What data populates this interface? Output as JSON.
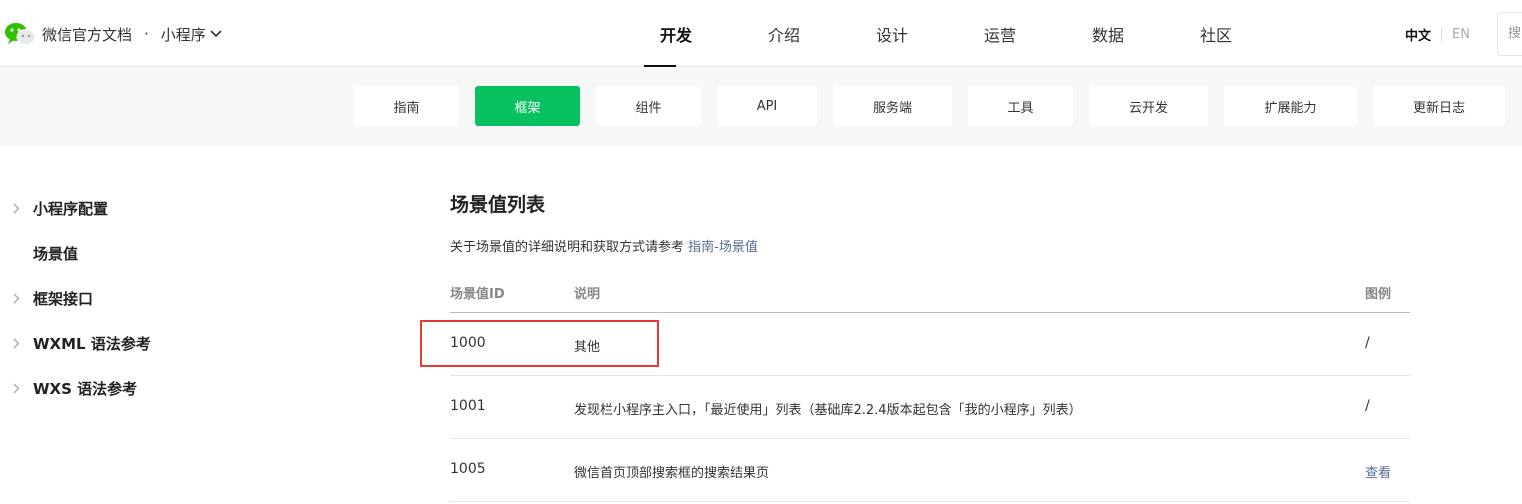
{
  "header": {
    "brand_title": "微信官方文档",
    "brand_separator": "·",
    "product": "小程序",
    "nav": [
      "开发",
      "介绍",
      "设计",
      "运营",
      "数据",
      "社区"
    ],
    "active_nav": "开发",
    "lang_zh": "中文",
    "lang_en": "EN",
    "search_placeholder": "搜"
  },
  "subnav": {
    "tabs": [
      "指南",
      "框架",
      "组件",
      "API",
      "服务端",
      "工具",
      "云开发",
      "扩展能力",
      "更新日志"
    ],
    "active": "框架",
    "accent": "#07c160"
  },
  "sidebar": {
    "items": [
      {
        "label": "小程序配置",
        "expandable": true
      },
      {
        "label": "场景值",
        "expandable": false
      },
      {
        "label": "框架接口",
        "expandable": true
      },
      {
        "label": "WXML 语法参考",
        "expandable": true
      },
      {
        "label": "WXS 语法参考",
        "expandable": true
      }
    ]
  },
  "main": {
    "title": "场景值列表",
    "intro_text": "关于场景值的详细说明和获取方式请参考",
    "intro_link": "指南-场景值",
    "columns": [
      "场景值ID",
      "说明",
      "图例"
    ],
    "rows": [
      {
        "id": "1000",
        "desc": "其他",
        "example": "/"
      },
      {
        "id": "1001",
        "desc": "发现栏小程序主入口，「最近使用」列表（基础库2.2.4版本起包含「我的小程序」列表）",
        "example": "/"
      },
      {
        "id": "1005",
        "desc": "微信首页顶部搜索框的搜索结果页",
        "example": "查看"
      }
    ],
    "highlight_color": "#e53935",
    "link_color": "#576b95"
  }
}
